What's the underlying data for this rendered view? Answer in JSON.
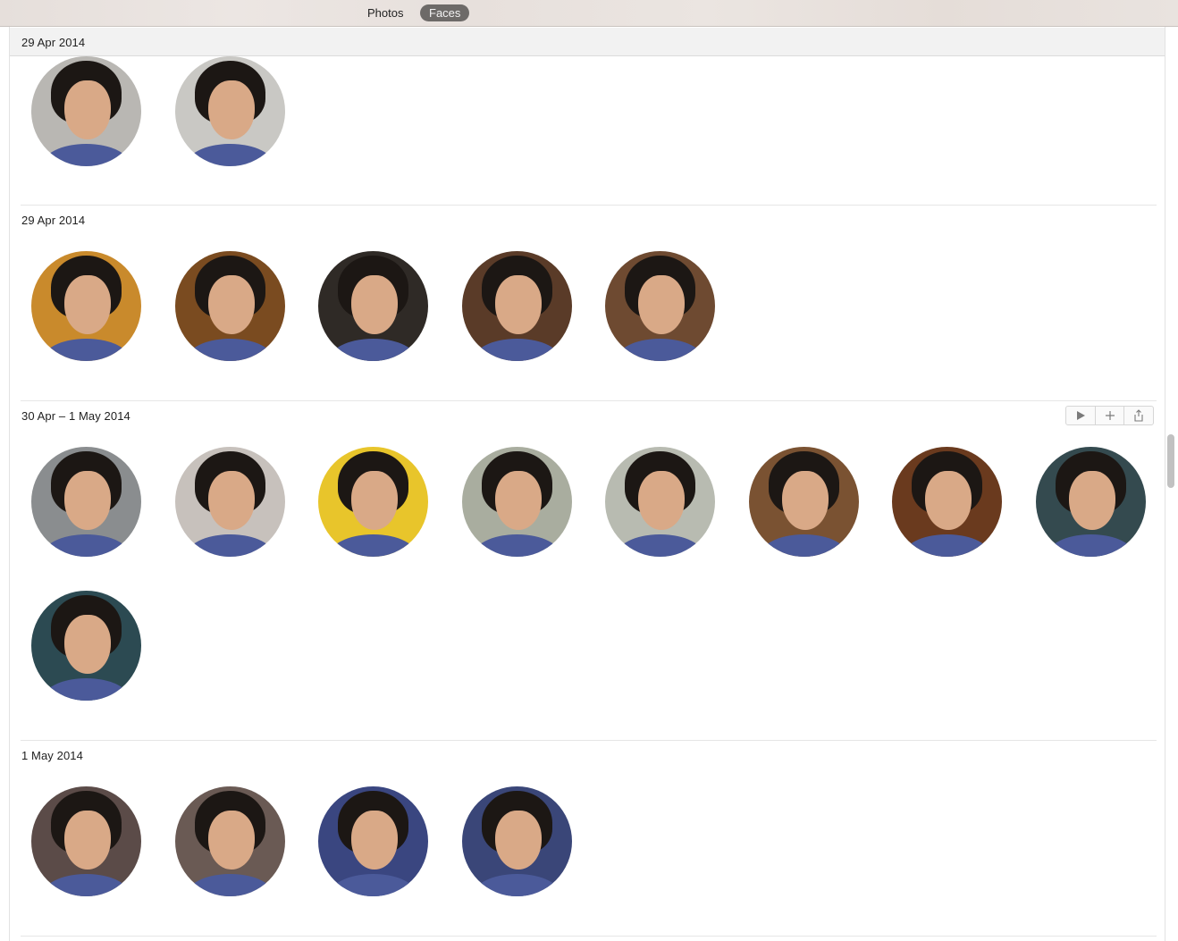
{
  "toolbar": {
    "photos_label": "Photos",
    "faces_label": "Faces"
  },
  "sections": [
    {
      "title": "29 Apr 2014"
    },
    {
      "title": "29 Apr 2014"
    },
    {
      "title": "30 Apr – 1 May 2014"
    },
    {
      "title": "1 May 2014"
    }
  ],
  "section_actions": {
    "play_icon": "play-icon",
    "add_icon": "plus-icon",
    "share_icon": "share-icon"
  },
  "face_thumbnails": [
    {
      "section": 0,
      "bg": "#b9b7b3"
    },
    {
      "section": 0,
      "bg": "#c9c8c4"
    },
    {
      "section": 1,
      "bg": "#c98a2c"
    },
    {
      "section": 1,
      "bg": "#7a4b20"
    },
    {
      "section": 1,
      "bg": "#2f2a26"
    },
    {
      "section": 1,
      "bg": "#5a3b28"
    },
    {
      "section": 1,
      "bg": "#6e4a31"
    },
    {
      "section": 2,
      "bg": "#8a8d8f"
    },
    {
      "section": 2,
      "bg": "#c7c1bc"
    },
    {
      "section": 2,
      "bg": "#e8c52b"
    },
    {
      "section": 2,
      "bg": "#a9ad9f"
    },
    {
      "section": 2,
      "bg": "#b8bbb1"
    },
    {
      "section": 2,
      "bg": "#7a5232"
    },
    {
      "section": 2,
      "bg": "#6a3a1e"
    },
    {
      "section": 2,
      "bg": "#344a4f"
    },
    {
      "section": 2,
      "bg": "#2c4a52"
    },
    {
      "section": 3,
      "bg": "#5b4b48"
    },
    {
      "section": 3,
      "bg": "#6a5a54"
    },
    {
      "section": 3,
      "bg": "#3a4680"
    },
    {
      "section": 3,
      "bg": "#3a4678"
    }
  ]
}
